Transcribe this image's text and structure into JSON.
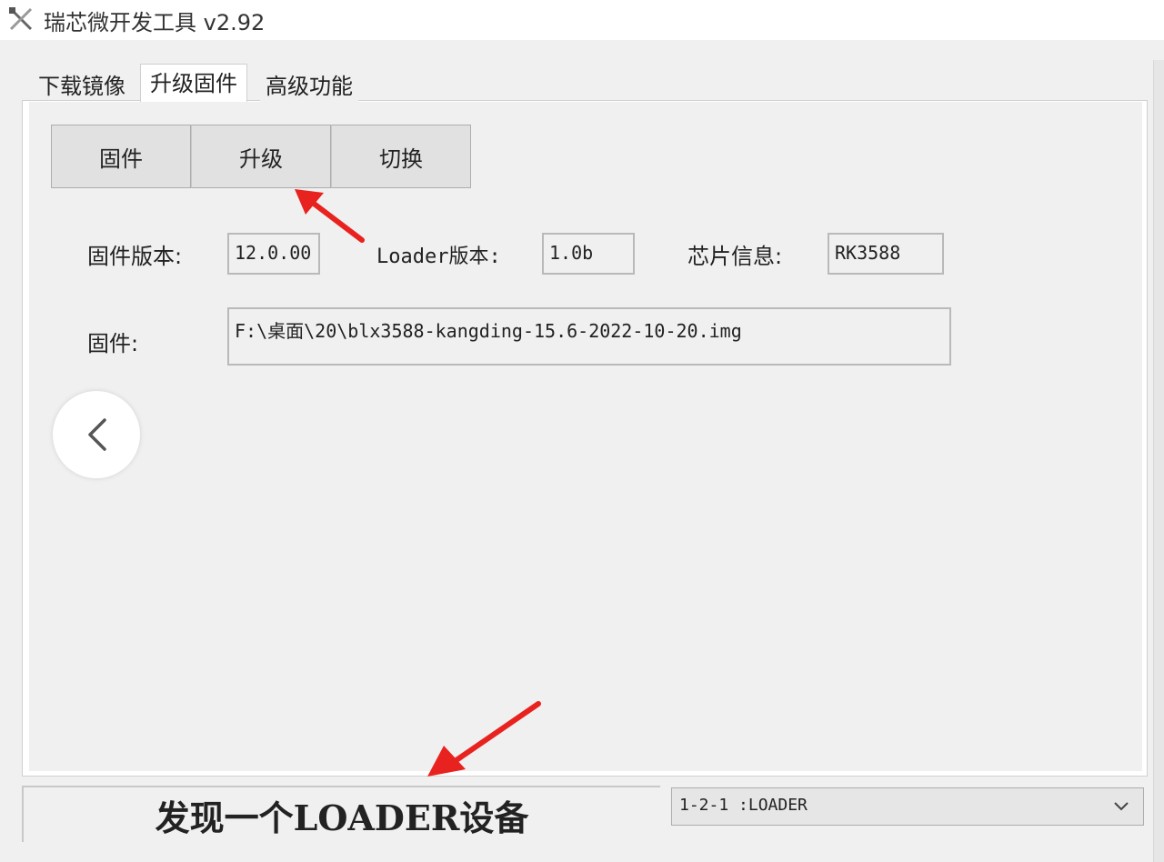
{
  "window": {
    "title": "瑞芯微开发工具 v2.92",
    "icon": "tool-app-icon"
  },
  "tabs": [
    {
      "label": "下载镜像",
      "active": false
    },
    {
      "label": "升级固件",
      "active": true
    },
    {
      "label": "高级功能",
      "active": false
    }
  ],
  "toolbar": {
    "firmware_label": "固件",
    "upgrade_label": "升级",
    "switch_label": "切换"
  },
  "info": {
    "firmware_version_label": "固件版本:",
    "firmware_version_value": "12.0.00",
    "loader_version_label": "Loader版本:",
    "loader_version_value": "1.0b",
    "chip_info_label": "芯片信息:",
    "chip_info_value": "RK3588",
    "firmware_path_label": "固件:",
    "firmware_path_value": "F:\\桌面\\20\\blx3588-kangding-15.6-2022-10-20.img"
  },
  "nav": {
    "back_icon": "chevron-left-icon"
  },
  "status": {
    "message": "发现一个LOADER设备",
    "device_selected": "1-2-1  :LOADER"
  },
  "colors": {
    "annotation_arrow": "#e8231f",
    "window_bg": "#f0f0f0"
  }
}
